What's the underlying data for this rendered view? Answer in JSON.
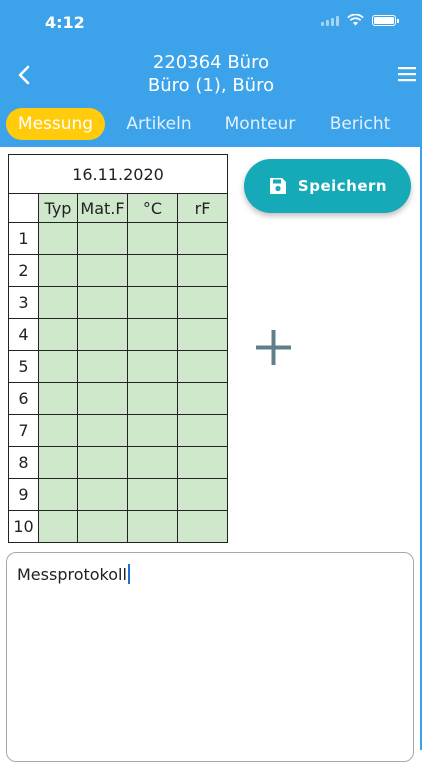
{
  "status_bar": {
    "time": "4:12"
  },
  "header": {
    "title_line1": "220364 Büro",
    "title_line2": "Büro (1), Büro"
  },
  "tabs": [
    {
      "label": "Messung",
      "active": true
    },
    {
      "label": "Artikeln",
      "active": false
    },
    {
      "label": "Monteur",
      "active": false
    },
    {
      "label": "Bericht",
      "active": false
    }
  ],
  "table": {
    "date": "16.11.2020",
    "columns": [
      "Typ",
      "Mat.F",
      "°C",
      "rF"
    ],
    "rows": [
      "1",
      "2",
      "3",
      "4",
      "5",
      "6",
      "7",
      "8",
      "9",
      "10"
    ]
  },
  "save_button": {
    "label": "Speichern",
    "icon": "floppy-disk-icon"
  },
  "add_button": {
    "icon": "plus-icon"
  },
  "notes": {
    "value": "Messprotokoll"
  },
  "colors": {
    "header": "#3ca3ea",
    "active_tab": "#ffcb0a",
    "save_button": "#16a9b8",
    "cell_fill": "#cfe8cc"
  }
}
